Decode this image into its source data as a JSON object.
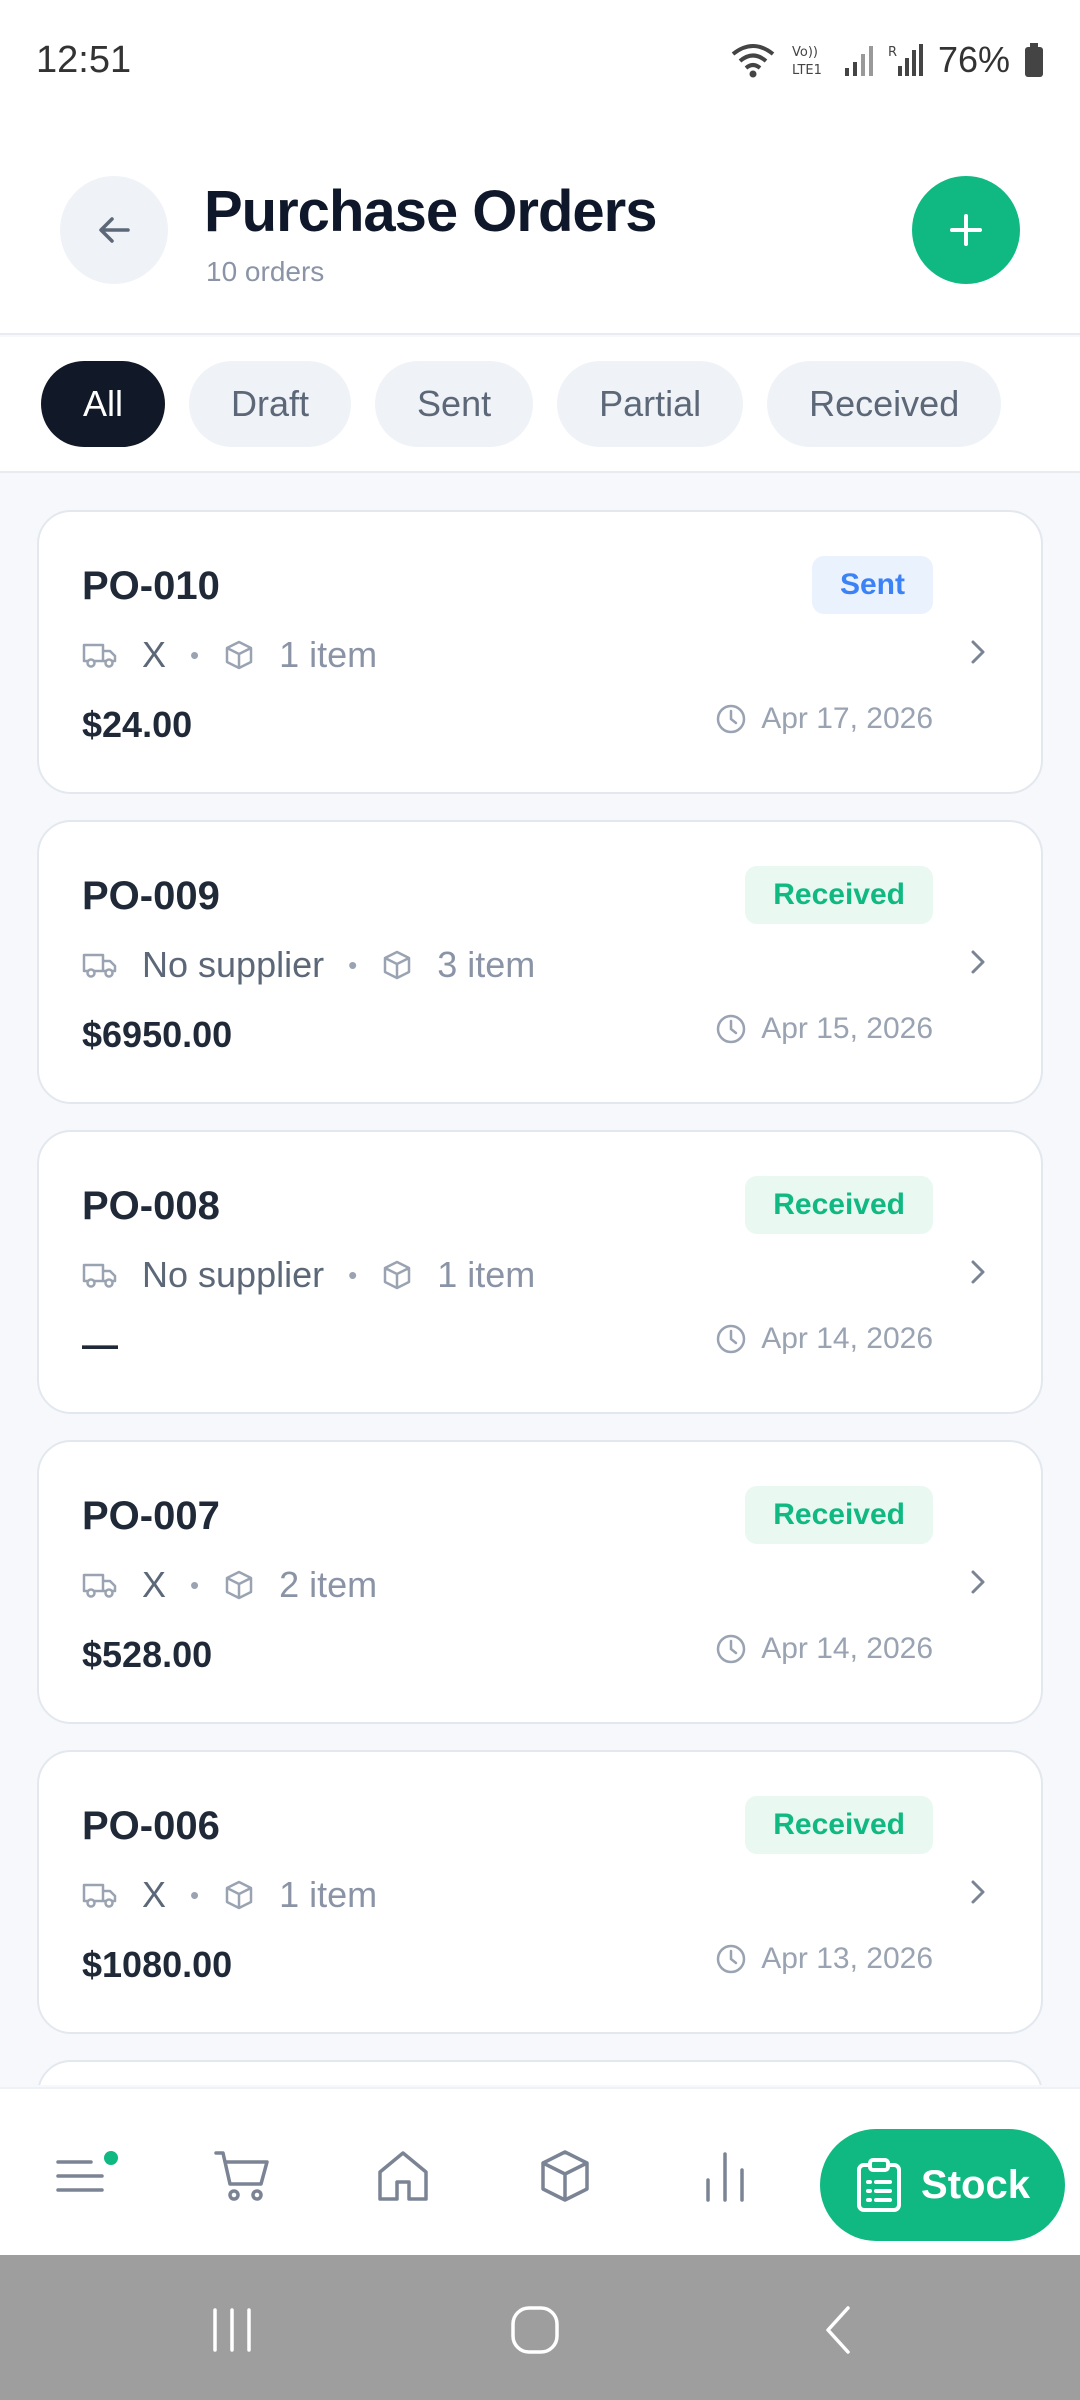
{
  "status_bar": {
    "time": "12:51",
    "battery": "76%"
  },
  "header": {
    "title": "Purchase Orders",
    "subtitle": "10 orders"
  },
  "filters": [
    {
      "label": "All",
      "active": true
    },
    {
      "label": "Draft",
      "active": false
    },
    {
      "label": "Sent",
      "active": false
    },
    {
      "label": "Partial",
      "active": false
    },
    {
      "label": "Received",
      "active": false
    }
  ],
  "orders": [
    {
      "number": "PO-010",
      "status": "Sent",
      "supplier": "X",
      "items": "1 item",
      "amount": "$24.00",
      "date": "Apr 17, 2026"
    },
    {
      "number": "PO-009",
      "status": "Received",
      "supplier": "No supplier",
      "items": "3 item",
      "amount": "$6950.00",
      "date": "Apr 15, 2026"
    },
    {
      "number": "PO-008",
      "status": "Received",
      "supplier": "No supplier",
      "items": "1 item",
      "amount": "—",
      "date": "Apr 14, 2026"
    },
    {
      "number": "PO-007",
      "status": "Received",
      "supplier": "X",
      "items": "2 item",
      "amount": "$528.00",
      "date": "Apr 14, 2026"
    },
    {
      "number": "PO-006",
      "status": "Received",
      "supplier": "X",
      "items": "1 item",
      "amount": "$1080.00",
      "date": "Apr 13, 2026"
    }
  ],
  "bottom_nav": {
    "stock_label": "Stock"
  },
  "colors": {
    "accent": "#10b981",
    "dark": "#111827",
    "sent_badge": "#3b82f6"
  }
}
